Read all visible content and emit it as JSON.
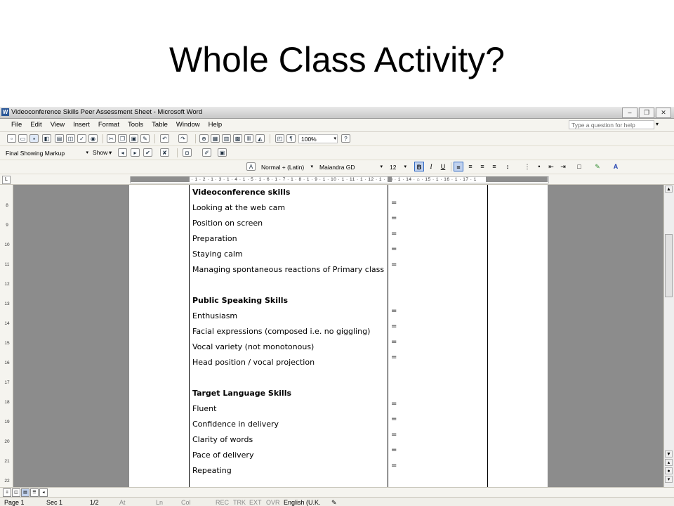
{
  "slide": {
    "title": "Whole Class Activity?"
  },
  "window": {
    "title": "Videoconference Skills Peer Assessment Sheet - Microsoft Word",
    "app_icon": "W",
    "controls": {
      "minimize": "‒",
      "restore": "❐",
      "close": "✕"
    }
  },
  "menubar": {
    "items": [
      "File",
      "Edit",
      "View",
      "Insert",
      "Format",
      "Tools",
      "Table",
      "Window",
      "Help"
    ],
    "help_placeholder": "Type a question for help"
  },
  "toolbar_standard": {
    "zoom": "100%"
  },
  "toolbar_reviewing": {
    "display_mode": "Final Showing Markup",
    "show_label": "Show"
  },
  "toolbar_formatting": {
    "style": "Normal + (Latin)",
    "font": "Maiandra GD",
    "size": "12",
    "bold": "B",
    "italic": "I",
    "underline": "U"
  },
  "ruler": {
    "scale": "3 · 1 · 2 · 1 · 1 · 1 · ⌂ · 1 · 1 · 2 · 1 · 3 · 1 · 4 · 1 · 5 · 1 · 6 · 1 · 7 · 1 · 8 · 1 · 9 · 1 · 10 · 1 · 11 · 1 · 12 · 1 · 13 · 1 · 14 · ⌂ · 15 · 1 · 16 · 1 · 17 · 1",
    "vticks": [
      "8",
      "9",
      "10",
      "11",
      "12",
      "13",
      "14",
      "15",
      "16",
      "17",
      "18",
      "19",
      "20",
      "21",
      "22"
    ]
  },
  "document": {
    "rows": [
      {
        "text": "Videoconference skills",
        "bold": true,
        "eq": false
      },
      {
        "text": "Looking at the web cam",
        "bold": false,
        "eq": true
      },
      {
        "text": "Position on screen",
        "bold": false,
        "eq": true
      },
      {
        "text": "Preparation",
        "bold": false,
        "eq": true
      },
      {
        "text": "Staying calm",
        "bold": false,
        "eq": true
      },
      {
        "text": "Managing spontaneous reactions of Primary class",
        "bold": false,
        "eq": true
      },
      {
        "text": "",
        "bold": false,
        "eq": false
      },
      {
        "text": "Public Speaking Skills",
        "bold": true,
        "eq": false
      },
      {
        "text": "Enthusiasm",
        "bold": false,
        "eq": true
      },
      {
        "text": "Facial expressions (composed i.e. no giggling)",
        "bold": false,
        "eq": true
      },
      {
        "text": "Vocal variety (not monotonous)",
        "bold": false,
        "eq": true
      },
      {
        "text": "Head position / vocal projection",
        "bold": false,
        "eq": true
      },
      {
        "text": "",
        "bold": false,
        "eq": false
      },
      {
        "text": "Target Language Skills",
        "bold": true,
        "eq": false
      },
      {
        "text": "Fluent",
        "bold": false,
        "eq": true
      },
      {
        "text": "Confidence in delivery",
        "bold": false,
        "eq": true
      },
      {
        "text": "Clarity of words",
        "bold": false,
        "eq": true
      },
      {
        "text": "Pace of delivery",
        "bold": false,
        "eq": true
      },
      {
        "text": "Repeating",
        "bold": false,
        "eq": true
      }
    ],
    "eq_symbol": "="
  },
  "statusbar": {
    "page": "Page 1",
    "sec": "Sec 1",
    "pages": "1/2",
    "at": "At",
    "ln": "Ln",
    "col": "Col",
    "rec": "REC",
    "trk": "TRK",
    "ext": "EXT",
    "ovr": "OVR",
    "lang": "English (U.K."
  }
}
